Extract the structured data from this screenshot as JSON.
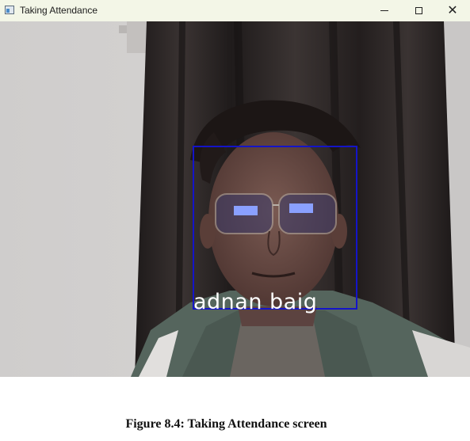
{
  "window": {
    "title": "Taking Attendance"
  },
  "controls": {
    "minimize": "–",
    "maximize": "□",
    "close": "✕"
  },
  "camera": {
    "detected_name": "adnan baig",
    "box_color": "#1414c8",
    "label_color": "#ffffff"
  },
  "caption": "Figure 8.4: Taking Attendance screen"
}
